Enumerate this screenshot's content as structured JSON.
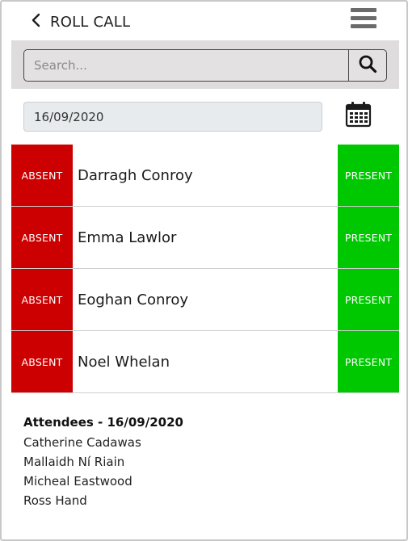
{
  "header": {
    "title": "ROLL CALL",
    "back_icon": "chevron-left-icon",
    "menu_icon": "hamburger-menu-icon"
  },
  "search": {
    "placeholder": "Search...",
    "value": "",
    "button_icon": "search-icon"
  },
  "date": {
    "value": "16/09/2020",
    "calendar_icon": "calendar-icon"
  },
  "roster": {
    "absent_label": "ABSENT",
    "present_label": "PRESENT",
    "students": [
      {
        "name": "Darragh Conroy"
      },
      {
        "name": "Emma Lawlor"
      },
      {
        "name": "Eoghan Conroy"
      },
      {
        "name": "Noel Whelan"
      }
    ]
  },
  "attendees": {
    "heading_label": "Attendees",
    "heading_date": "16/09/2020",
    "names": [
      "Catherine Cadawas",
      "Mallaidh Ní Riain",
      "Micheal Eastwood",
      "Ross Hand"
    ]
  },
  "colors": {
    "absent": "#cc0000",
    "present": "#00c800",
    "search_band": "#dedcdc",
    "date_field": "#e8ebee"
  }
}
